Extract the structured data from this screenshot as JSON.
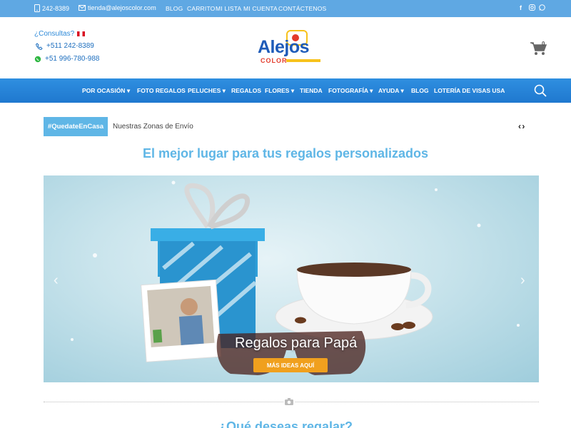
{
  "topbar": {
    "phone": "242-8389",
    "email": "tienda@alejoscolor.com",
    "links": [
      "BLOG",
      "CARRITO",
      "MI LISTA",
      "MI CUENTA",
      "CONTÁCTENOS"
    ],
    "social": [
      "facebook-icon",
      "instagram-icon",
      "whatsapp-icon"
    ]
  },
  "header": {
    "consultas": "¿Consultas?",
    "phone_landline": "+511 242-8389",
    "phone_whatsapp": "+51 996-780-988",
    "logo_main": "Alejos",
    "logo_sub": "COLOR",
    "cart_count": "0"
  },
  "nav": {
    "items": [
      "POR OCASIÓN",
      "FOTO REGALOS",
      "PELUCHES",
      "REGALOS",
      "FLORES",
      "TIENDA",
      "FOTOGRAFÍA",
      "AYUDA",
      "BLOG",
      "LOTERÍA DE VISAS USA"
    ],
    "dropdown": "▾"
  },
  "ticker": {
    "tag": "#QuedateEnCasa",
    "text": "Nuestras Zonas de Envío",
    "arrows": "‹ ›"
  },
  "headline": "El mejor lugar para tus regalos personalizados",
  "hero": {
    "caption": "Regalos para Papá",
    "button": "MÁS IDEAS AQUÍ",
    "prev": "‹",
    "next": "›"
  },
  "subheadline": "¿Qué deseas regalar?",
  "colors": {
    "topbar": "#5fa8e3",
    "nav": "#1f78cf",
    "accent": "#5fb6e6",
    "button": "#f0a01e"
  }
}
